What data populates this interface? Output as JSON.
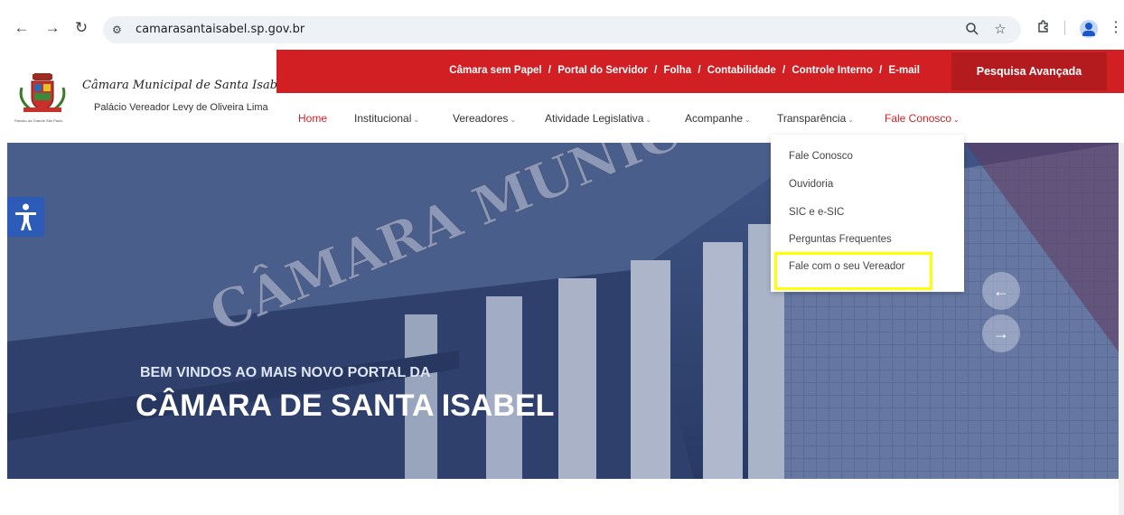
{
  "browser": {
    "url": "camarasantaisabel.sp.gov.br",
    "icons": [
      "back-icon",
      "forward-icon",
      "reload-icon",
      "site-info-icon",
      "zoom-icon",
      "star-icon",
      "extensions-icon",
      "profile-avatar",
      "menu-icon"
    ]
  },
  "header": {
    "logo_title": "Câmara Municipal de Santa Isabel",
    "logo_subtitle": "Palácio Vereador Levy de Oliveira Lima",
    "logo_tagline": "Paraíso da Grande São Paulo",
    "top_links": [
      "Câmara sem Papel",
      "Portal do Servidor",
      "Folha",
      "Contabilidade",
      "Controle Interno",
      "E-mail"
    ],
    "top_separator": "/",
    "search_button": "Pesquisa Avançada"
  },
  "nav": {
    "items": [
      {
        "label": "Home",
        "active": true,
        "has_caret": false
      },
      {
        "label": "Institucional",
        "active": false,
        "has_caret": true
      },
      {
        "label": "Vereadores",
        "active": false,
        "has_caret": true
      },
      {
        "label": "Atividade Legislativa",
        "active": false,
        "has_caret": true
      },
      {
        "label": "Acompanhe",
        "active": false,
        "has_caret": true
      },
      {
        "label": "Transparência",
        "active": false,
        "has_caret": true
      },
      {
        "label": "Fale Conosco",
        "active": true,
        "has_caret": true
      }
    ],
    "caret": "⌄"
  },
  "dropdown": {
    "items": [
      "Fale Conosco",
      "Ouvidoria",
      "SIC e e-SIC",
      "Perguntas Frequentes",
      "Fale com o seu Vereador"
    ],
    "highlighted_item": "Fale com o seu Vereador"
  },
  "hero": {
    "building_sign": "CÂMARA MUNICIPAL",
    "line1": "BEM VINDOS AO MAIS NOVO PORTAL DA",
    "line2": "CÂMARA DE SANTA ISABEL",
    "prev_arrow": "←",
    "next_arrow": "→"
  },
  "colors": {
    "brand_red": "#d21f23",
    "dark_red": "#b31b1e",
    "highlight_yellow": "#ffff00",
    "hero_blue": "#3b4f78",
    "accessibility_blue": "#2d5bb8"
  }
}
